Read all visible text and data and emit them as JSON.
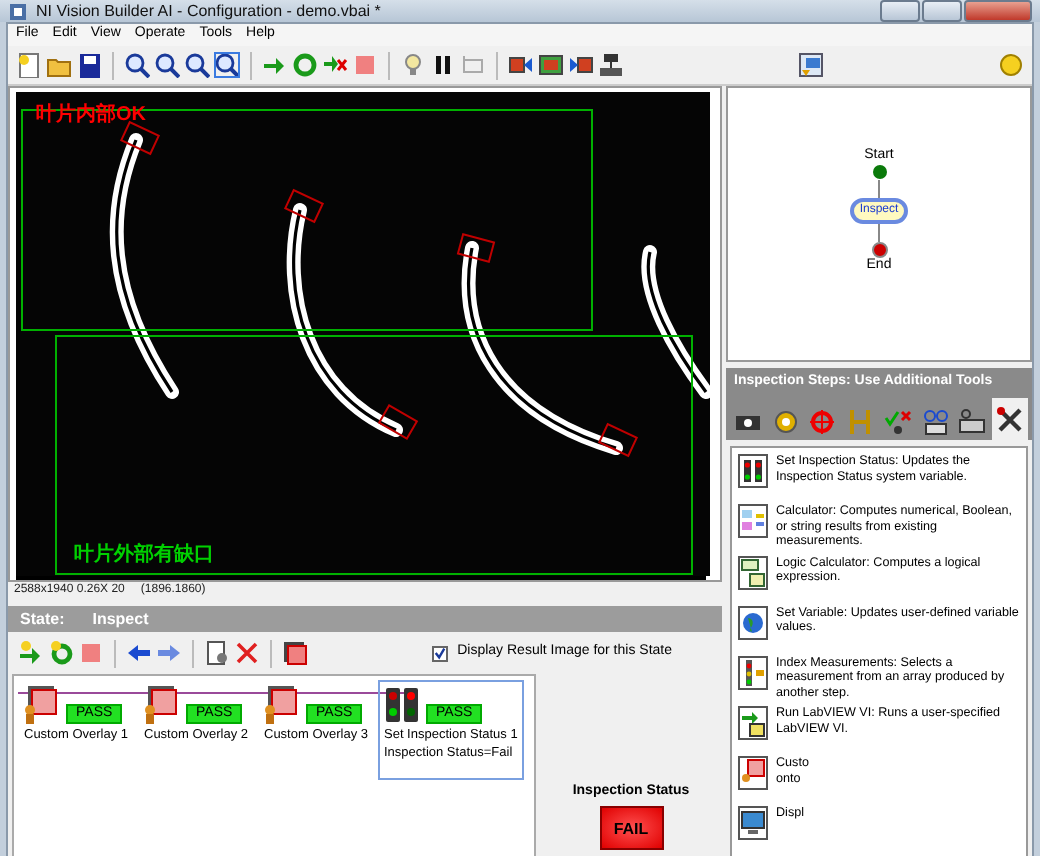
{
  "window": {
    "title": "NI Vision Builder AI - Configuration - demo.vbai *"
  },
  "menu": [
    "File",
    "Edit",
    "View",
    "Operate",
    "Tools",
    "Help"
  ],
  "image": {
    "overlays": [
      {
        "label": "叶片内部OK",
        "color": "#ff0000"
      },
      {
        "label": "叶片外部有缺口",
        "color": "#00d000"
      }
    ],
    "info": "2588x1940 0.26X 20",
    "coords": "(1896.1860)"
  },
  "state": {
    "label": "State:",
    "name": "Inspect"
  },
  "display_result": {
    "label": "Display Result Image for this State",
    "checked": true
  },
  "steps": [
    {
      "kind": "overlay",
      "name": "Custom Overlay 1",
      "result": "PASS",
      "selected": false
    },
    {
      "kind": "overlay",
      "name": "Custom Overlay 2",
      "result": "PASS",
      "selected": false
    },
    {
      "kind": "overlay",
      "name": "Custom Overlay 3",
      "result": "PASS",
      "selected": false
    },
    {
      "kind": "status",
      "name": "Set Inspection Status 1",
      "result": "PASS",
      "detail": "Inspection Status=Fail",
      "selected": true
    }
  ],
  "inspection_status": {
    "label": "Inspection Status",
    "value": "FAIL"
  },
  "diagram": {
    "nodes": [
      {
        "kind": "start",
        "label": "Start"
      },
      {
        "kind": "state",
        "label": "Inspect",
        "selected": true
      },
      {
        "kind": "end",
        "label": "End"
      }
    ]
  },
  "tools": {
    "title": "Inspection Steps: Use Additional Tools",
    "tabs": [
      {
        "selected": false
      },
      {
        "selected": false
      },
      {
        "selected": false
      },
      {
        "selected": false
      },
      {
        "selected": false
      },
      {
        "selected": false
      },
      {
        "selected": false
      },
      {
        "selected": true
      }
    ],
    "items": [
      {
        "kind": "status",
        "lines": [
          "Set Inspection Status:  Updates the Inspection Status system variable."
        ]
      },
      {
        "kind": "calculator",
        "lines": [
          "Calculator:  Computes numerical, Boolean, or string results from existing measurements."
        ]
      },
      {
        "kind": "logic",
        "lines": [
          "Logic Calculator:  Computes a logical expression."
        ]
      },
      {
        "kind": "variable",
        "lines": [
          "Set Variable:  Updates user-defined variable values."
        ]
      },
      {
        "kind": "index",
        "lines": [
          "Index Measurements:  Selects a measurement from an array produced by another step."
        ]
      },
      {
        "kind": "labview",
        "lines": [
          "Run LabVIEW VI:  Runs a user-specified LabVIEW VI."
        ]
      },
      {
        "kind": "overlay",
        "lines": [
          "Custo",
          "onto"
        ]
      },
      {
        "kind": "display",
        "lines": [
          "Displ"
        ]
      }
    ]
  }
}
